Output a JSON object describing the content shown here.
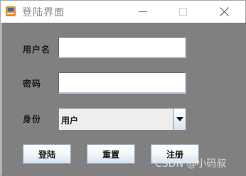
{
  "window": {
    "title": "登陆界面"
  },
  "form": {
    "username_label": "用户名",
    "username_value": "",
    "password_label": "密码",
    "password_value": "",
    "role_label": "身份",
    "role_selected": "用户"
  },
  "buttons": {
    "login": "登陆",
    "reset": "重置",
    "register": "注册"
  },
  "watermark": "CSDN @小码叔",
  "icons": {
    "app": "app-icon",
    "minimize": "minimize-icon",
    "maximize": "maximize-icon",
    "close": "close-icon",
    "dropdown": "chevron-down-icon"
  },
  "colors": {
    "content_background": "#808080",
    "title_text": "#888888",
    "button_border": "#8da2b7"
  }
}
